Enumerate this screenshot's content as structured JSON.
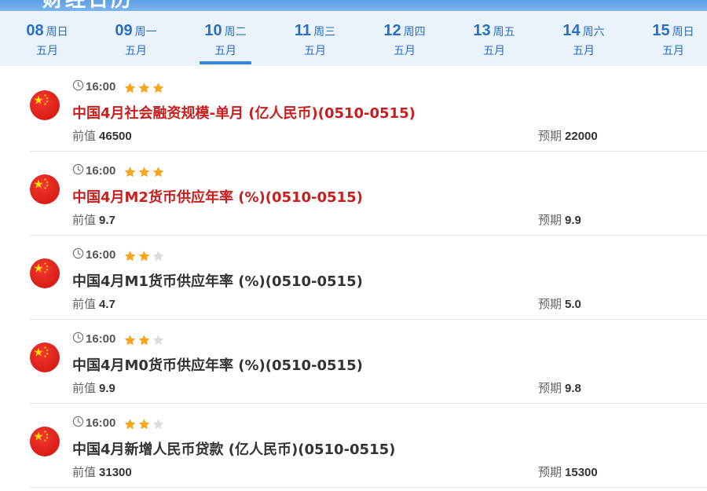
{
  "header": {
    "title": "财经日历"
  },
  "colors": {
    "accent": "#2a6fc4",
    "important_title": "#c81e1e",
    "star_on": "#f5a623",
    "star_off": "#dddddd"
  },
  "dates": [
    {
      "day": "08",
      "weekday": "周日",
      "month": "五月",
      "active": false
    },
    {
      "day": "09",
      "weekday": "周一",
      "month": "五月",
      "active": false
    },
    {
      "day": "10",
      "weekday": "周二",
      "month": "五月",
      "active": true
    },
    {
      "day": "11",
      "weekday": "周三",
      "month": "五月",
      "active": false
    },
    {
      "day": "12",
      "weekday": "周四",
      "month": "五月",
      "active": false
    },
    {
      "day": "13",
      "weekday": "周五",
      "month": "五月",
      "active": false
    },
    {
      "day": "14",
      "weekday": "周六",
      "month": "五月",
      "active": false
    },
    {
      "day": "15",
      "weekday": "周日",
      "month": "五月",
      "active": false
    }
  ],
  "labels": {
    "previous": "前值",
    "forecast": "预期"
  },
  "events": [
    {
      "time": "16:00",
      "stars": 3,
      "title": "中国4月社会融资规模-单月 (亿人民币)(0510-0515)",
      "important": true,
      "previous": "46500",
      "forecast": "22000",
      "flag": "china-flag-icon"
    },
    {
      "time": "16:00",
      "stars": 3,
      "title": "中国4月M2货币供应年率 (%)(0510-0515)",
      "important": true,
      "previous": "9.7",
      "forecast": "9.9",
      "flag": "china-flag-icon"
    },
    {
      "time": "16:00",
      "stars": 2,
      "title": "中国4月M1货币供应年率 (%)(0510-0515)",
      "important": false,
      "previous": "4.7",
      "forecast": "5.0",
      "flag": "china-flag-icon"
    },
    {
      "time": "16:00",
      "stars": 2,
      "title": "中国4月M0货币供应年率 (%)(0510-0515)",
      "important": false,
      "previous": "9.9",
      "forecast": "9.8",
      "flag": "china-flag-icon"
    },
    {
      "time": "16:00",
      "stars": 2,
      "title": "中国4月新增人民币贷款 (亿人民币)(0510-0515)",
      "important": false,
      "previous": "31300",
      "forecast": "15300",
      "flag": "china-flag-icon"
    }
  ]
}
